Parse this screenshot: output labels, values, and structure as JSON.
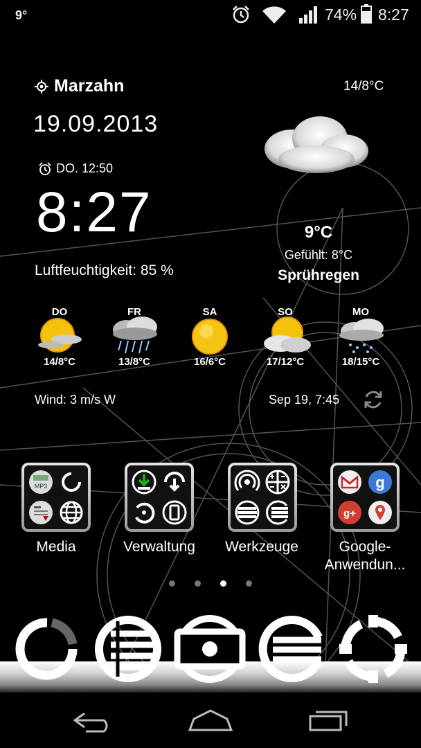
{
  "status_bar": {
    "left_temp": "9°",
    "battery": "74%",
    "time": "8:27"
  },
  "weather_widget": {
    "location": "Marzahn",
    "date": "19.09.2013",
    "alarm": "DO. 12:50",
    "clock": "8:27",
    "humidity": "Luftfeuchtigkeit: 85 %",
    "hi_lo": "14/8°C",
    "current_temp": "9°C",
    "felt": "Gefühlt: 8°C",
    "condition": "Sprühregen",
    "forecast": [
      {
        "day": "DO",
        "temps": "14/8°C",
        "icon": "sun-cloud-icon"
      },
      {
        "day": "FR",
        "temps": "13/8°C",
        "icon": "rain-cloud-icon"
      },
      {
        "day": "SA",
        "temps": "16/6°C",
        "icon": "sun-icon"
      },
      {
        "day": "SO",
        "temps": "17/12°C",
        "icon": "cloud-sun-icon"
      },
      {
        "day": "MO",
        "temps": "18/15°C",
        "icon": "light-rain-icon"
      }
    ],
    "wind": "Wind: 3 m/s W",
    "updated": "Sep 19, 7:45"
  },
  "folders": [
    {
      "label": "Media"
    },
    {
      "label": "Verwaltung"
    },
    {
      "label": "Werkzeuge"
    },
    {
      "label": "Google-\nAnwendun..."
    }
  ],
  "page_indicator": {
    "pages": 4,
    "current": 3
  },
  "dock": [
    "loop-icon",
    "list-icon",
    "camera-icon",
    "menu-icon",
    "settings-gear-icon"
  ],
  "nav": [
    "back-icon",
    "home-icon",
    "recents-icon"
  ]
}
